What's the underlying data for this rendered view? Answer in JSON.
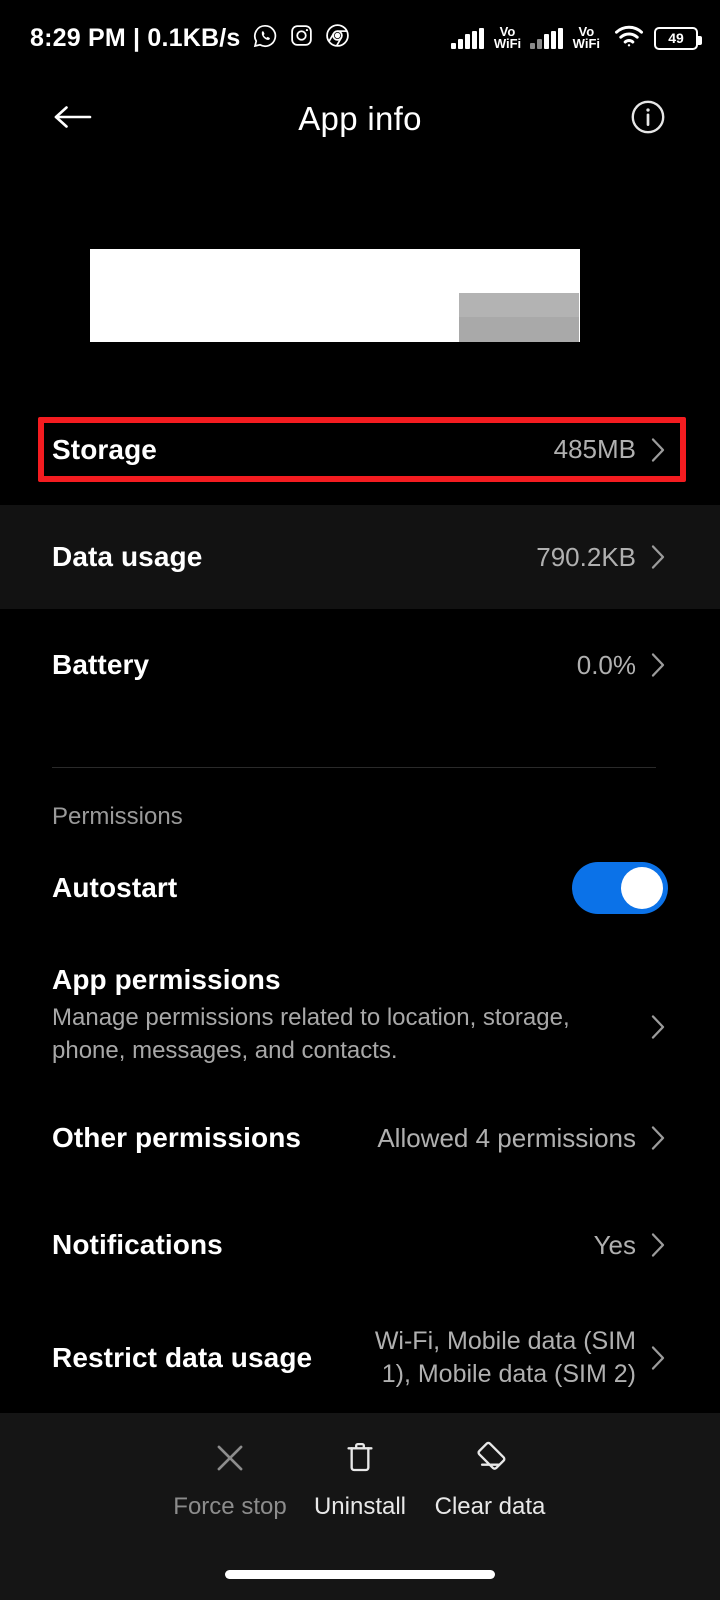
{
  "status_bar": {
    "clock": "8:29 PM",
    "separator": "|",
    "network_speed": "0.1KB/s",
    "left_icons": [
      "whatsapp-icon",
      "instagram-icon",
      "chrome-icon"
    ],
    "sim1_label": "Vo\nWiFi",
    "sim1_line1": "Vo",
    "sim1_line2": "WiFi",
    "sim2_line1": "Vo",
    "sim2_line2": "WiFi",
    "wifi_icon": "wifi-icon",
    "battery_percent": "49"
  },
  "app_bar": {
    "back_icon": "back-arrow-icon",
    "title": "App info",
    "info_icon": "info-circle-icon"
  },
  "app_header": {
    "redacted": true,
    "note": "app name and package redacted with white block"
  },
  "rows": [
    {
      "name": "storage",
      "title": "Storage",
      "value": "485MB",
      "chevron": "chevron-right-icon",
      "highlighted": true,
      "shaded": false
    },
    {
      "name": "data-usage",
      "title": "Data usage",
      "value": "790.2KB",
      "chevron": "chevron-right-icon",
      "highlighted": false,
      "shaded": true
    },
    {
      "name": "battery",
      "title": "Battery",
      "value": "0.0%",
      "chevron": "chevron-right-icon",
      "highlighted": false,
      "shaded": false
    }
  ],
  "permissions_section": {
    "label": "Permissions",
    "autostart": {
      "title": "Autostart",
      "toggle_on": true
    },
    "app_permissions": {
      "title": "App permissions",
      "subtitle": "Manage permissions related to location, storage, phone, messages, and contacts.",
      "chevron": "chevron-right-icon"
    },
    "other_permissions": {
      "title": "Other permissions",
      "value": "Allowed 4 permissions",
      "chevron": "chevron-right-icon"
    },
    "notifications": {
      "title": "Notifications",
      "value": "Yes",
      "chevron": "chevron-right-icon"
    },
    "restrict_data_usage": {
      "title": "Restrict data usage",
      "value": "Wi-Fi, Mobile data (SIM 1), Mobile data (SIM 2)",
      "chevron": "chevron-right-icon"
    }
  },
  "bottom_actions": [
    {
      "name": "force-stop",
      "label": "Force stop",
      "icon": "close-x-icon",
      "enabled": false
    },
    {
      "name": "uninstall",
      "label": "Uninstall",
      "icon": "trash-icon",
      "enabled": true
    },
    {
      "name": "clear-data",
      "label": "Clear data",
      "icon": "eraser-icon",
      "enabled": true
    }
  ],
  "colors": {
    "background": "#000000",
    "row_shaded": "#121212",
    "highlight_red": "#f41c20",
    "toggle_blue": "#0b72e8",
    "value_gray": "#b0b0b0",
    "label_gray": "#9a9a9a",
    "bottom_bar": "#151515"
  }
}
